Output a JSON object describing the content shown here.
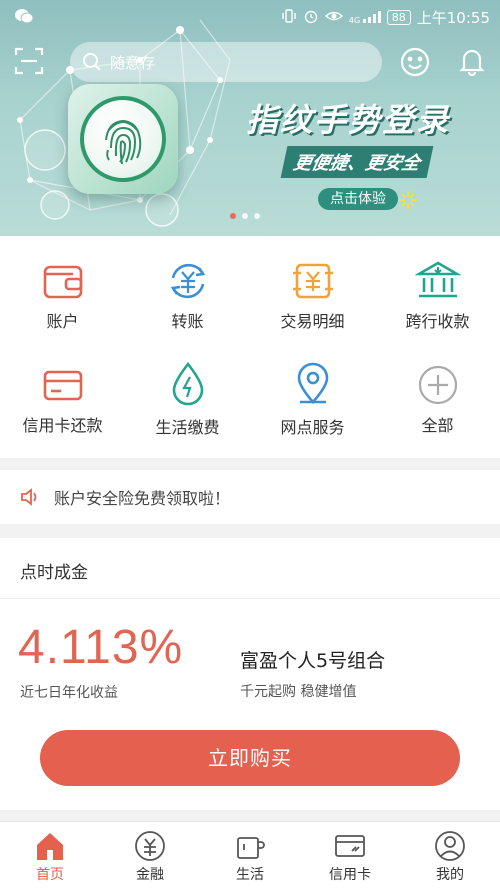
{
  "status_bar": {
    "battery": "88",
    "time": "上午10:55",
    "network": "4G"
  },
  "search": {
    "placeholder": "随意存"
  },
  "banner": {
    "title": "指纹手势登录",
    "subtitle": "更便捷、更安全",
    "cta": "点击体验",
    "dots": 3,
    "active_dot": 0
  },
  "quick_menu": [
    {
      "label": "账户",
      "icon": "wallet-icon"
    },
    {
      "label": "转账",
      "icon": "transfer-yuan-icon"
    },
    {
      "label": "交易明细",
      "icon": "transaction-detail-icon"
    },
    {
      "label": "跨行收款",
      "icon": "bank-icon"
    },
    {
      "label": "信用卡还款",
      "icon": "credit-card-icon"
    },
    {
      "label": "生活缴费",
      "icon": "water-drop-bolt-icon"
    },
    {
      "label": "网点服务",
      "icon": "location-pin-icon"
    },
    {
      "label": "全部",
      "icon": "plus-circle-icon"
    }
  ],
  "notice": {
    "text": "账户安全险免费领取啦！",
    "icon": "speaker-icon"
  },
  "product": {
    "section_title": "点时成金",
    "rate": "4.113%",
    "rate_label": "近七日年化收益",
    "name": "富盈个人5号组合",
    "desc": "千元起购 稳健增值",
    "buy_label": "立即购买"
  },
  "bottom_nav": [
    {
      "label": "首页",
      "icon": "home-icon",
      "active": true
    },
    {
      "label": "金融",
      "icon": "yuan-circle-icon",
      "active": false
    },
    {
      "label": "生活",
      "icon": "cup-icon",
      "active": false
    },
    {
      "label": "信用卡",
      "icon": "card-icon",
      "active": false
    },
    {
      "label": "我的",
      "icon": "user-icon",
      "active": false
    }
  ],
  "colors": {
    "accent": "#e4604f",
    "teal": "#2d7f74",
    "icon_red": "#e06553",
    "icon_orange": "#f0a33a",
    "icon_teal": "#22a58c",
    "icon_blue": "#3a8fd6"
  }
}
